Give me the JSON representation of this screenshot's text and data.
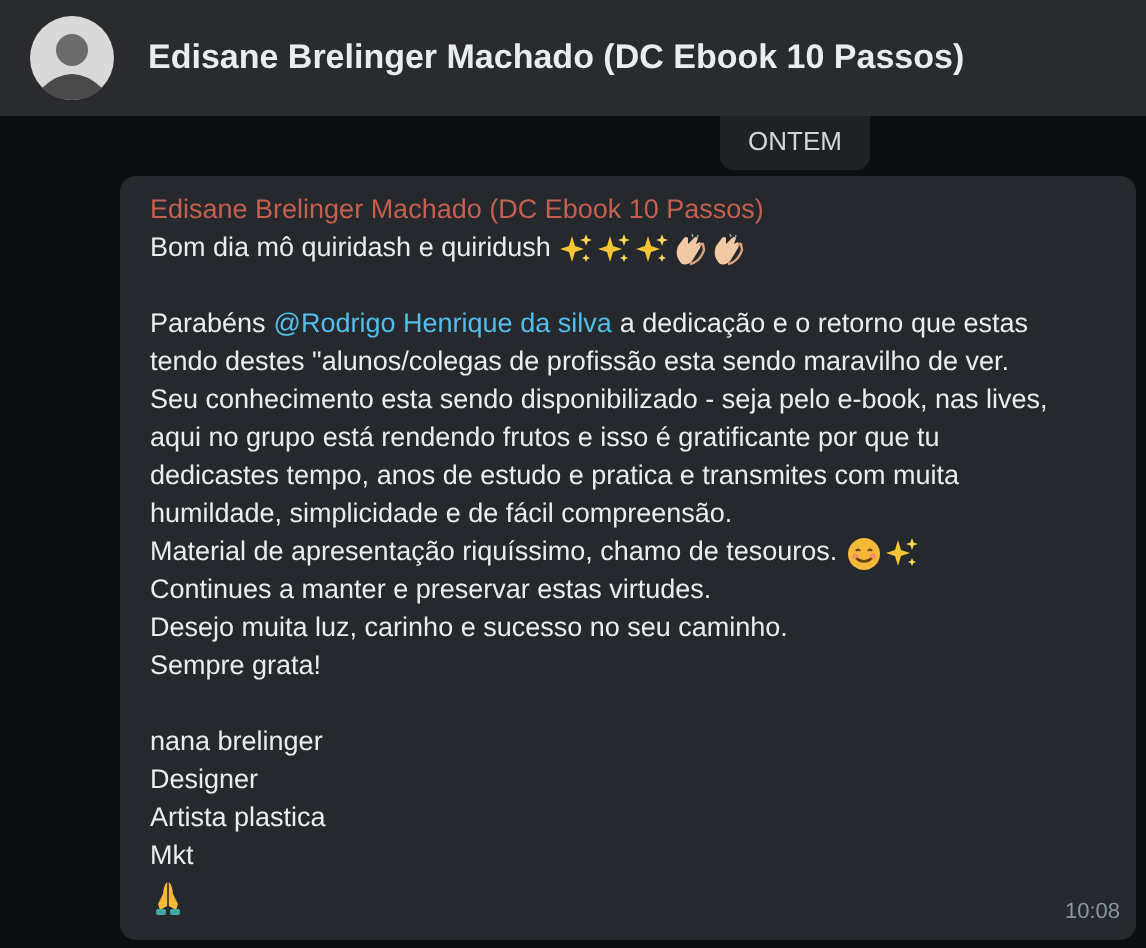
{
  "header": {
    "title": "Edisane Brelinger Machado (DC Ebook 10 Passos)"
  },
  "date_chip": "ONTEM",
  "message": {
    "sender": "Edisane Brelinger Machado (DC Ebook 10 Passos)",
    "paragraphs": [
      [
        {
          "text": "Bom dia mô quiridash e quiridush",
          "icons": [
            {
              "kind": "sparkles"
            },
            {
              "kind": "sparkles"
            },
            {
              "kind": "sparkles"
            },
            {
              "kind": "clap"
            },
            {
              "kind": "clap"
            }
          ]
        }
      ],
      [
        {
          "text": "Parabéns",
          "mention": "@Rodrigo Henrique da silva",
          "after": "a dedicação e o retorno que estas"
        },
        {
          "text": "tendo destes \"alunos/colegas de profissão esta sendo maravilho de ver."
        },
        {
          "text": "Seu conhecimento esta sendo disponibilizado - seja pelo e-book, nas lives,"
        },
        {
          "text": "aqui no grupo está rendendo frutos e isso é gratificante por que tu"
        },
        {
          "text": "dedicastes tempo, anos de estudo e pratica e transmites com muita"
        },
        {
          "text": "humildade, simplicidade e de fácil compreensão."
        },
        {
          "text": "Material de apresentação riquíssimo, chamo de tesouros.",
          "icons": [
            {
              "kind": "smile"
            },
            {
              "kind": "sparkles"
            }
          ]
        },
        {
          "text": "Continues a manter e preservar estas virtudes."
        },
        {
          "text": "Desejo muita luz, carinho e sucesso no seu caminho."
        },
        {
          "text": "Sempre grata!"
        }
      ],
      [
        {
          "text": "nana brelinger"
        },
        {
          "text": "Designer"
        },
        {
          "text": "Artista plastica"
        },
        {
          "text": "Mkt"
        },
        {
          "icons": [
            {
              "kind": "pray"
            }
          ]
        }
      ]
    ],
    "time": "10:08"
  }
}
